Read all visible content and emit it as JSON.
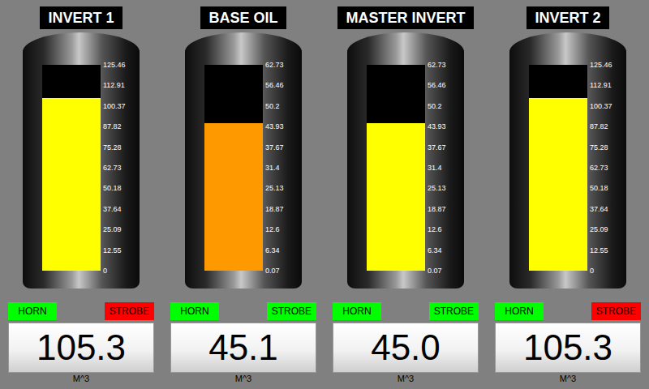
{
  "tanks": [
    {
      "title": "INVERT 1",
      "scale": [
        "125.46",
        "112.91",
        "100.37",
        "87.82",
        "75.28",
        "62.73",
        "50.18",
        "37.64",
        "25.09",
        "12.55",
        "0"
      ],
      "level": 0.839,
      "fill_color": "#ffff00",
      "horn": {
        "label": "HORN",
        "active": false
      },
      "strobe": {
        "label": "STROBE",
        "active": true
      },
      "reading": "105.3",
      "unit": "M^3"
    },
    {
      "title": "BASE OIL",
      "scale": [
        "62.73",
        "56.46",
        "50.2",
        "43.93",
        "37.67",
        "31.4",
        "25.13",
        "18.87",
        "12.6",
        "6.34",
        "0.07"
      ],
      "level": 0.717,
      "fill_color": "#ff9900",
      "horn": {
        "label": "HORN",
        "active": false
      },
      "strobe": {
        "label": "STROBE",
        "active": false
      },
      "reading": "45.1",
      "unit": "M^3"
    },
    {
      "title": "MASTER INVERT",
      "scale": [
        "62.73",
        "56.46",
        "50.2",
        "43.93",
        "37.67",
        "31.4",
        "25.13",
        "18.87",
        "12.6",
        "6.34",
        "0.07"
      ],
      "level": 0.716,
      "fill_color": "#ffff00",
      "horn": {
        "label": "HORN",
        "active": false
      },
      "strobe": {
        "label": "STROBE",
        "active": false
      },
      "reading": "45.0",
      "unit": "M^3"
    },
    {
      "title": "INVERT 2",
      "scale": [
        "125.46",
        "112.91",
        "100.37",
        "87.82",
        "75.28",
        "62.73",
        "50.18",
        "37.64",
        "25.09",
        "12.55",
        "0"
      ],
      "level": 0.839,
      "fill_color": "#ffff00",
      "horn": {
        "label": "HORN",
        "active": false
      },
      "strobe": {
        "label": "STROBE",
        "active": true
      },
      "reading": "105.3",
      "unit": "M^3"
    }
  ]
}
